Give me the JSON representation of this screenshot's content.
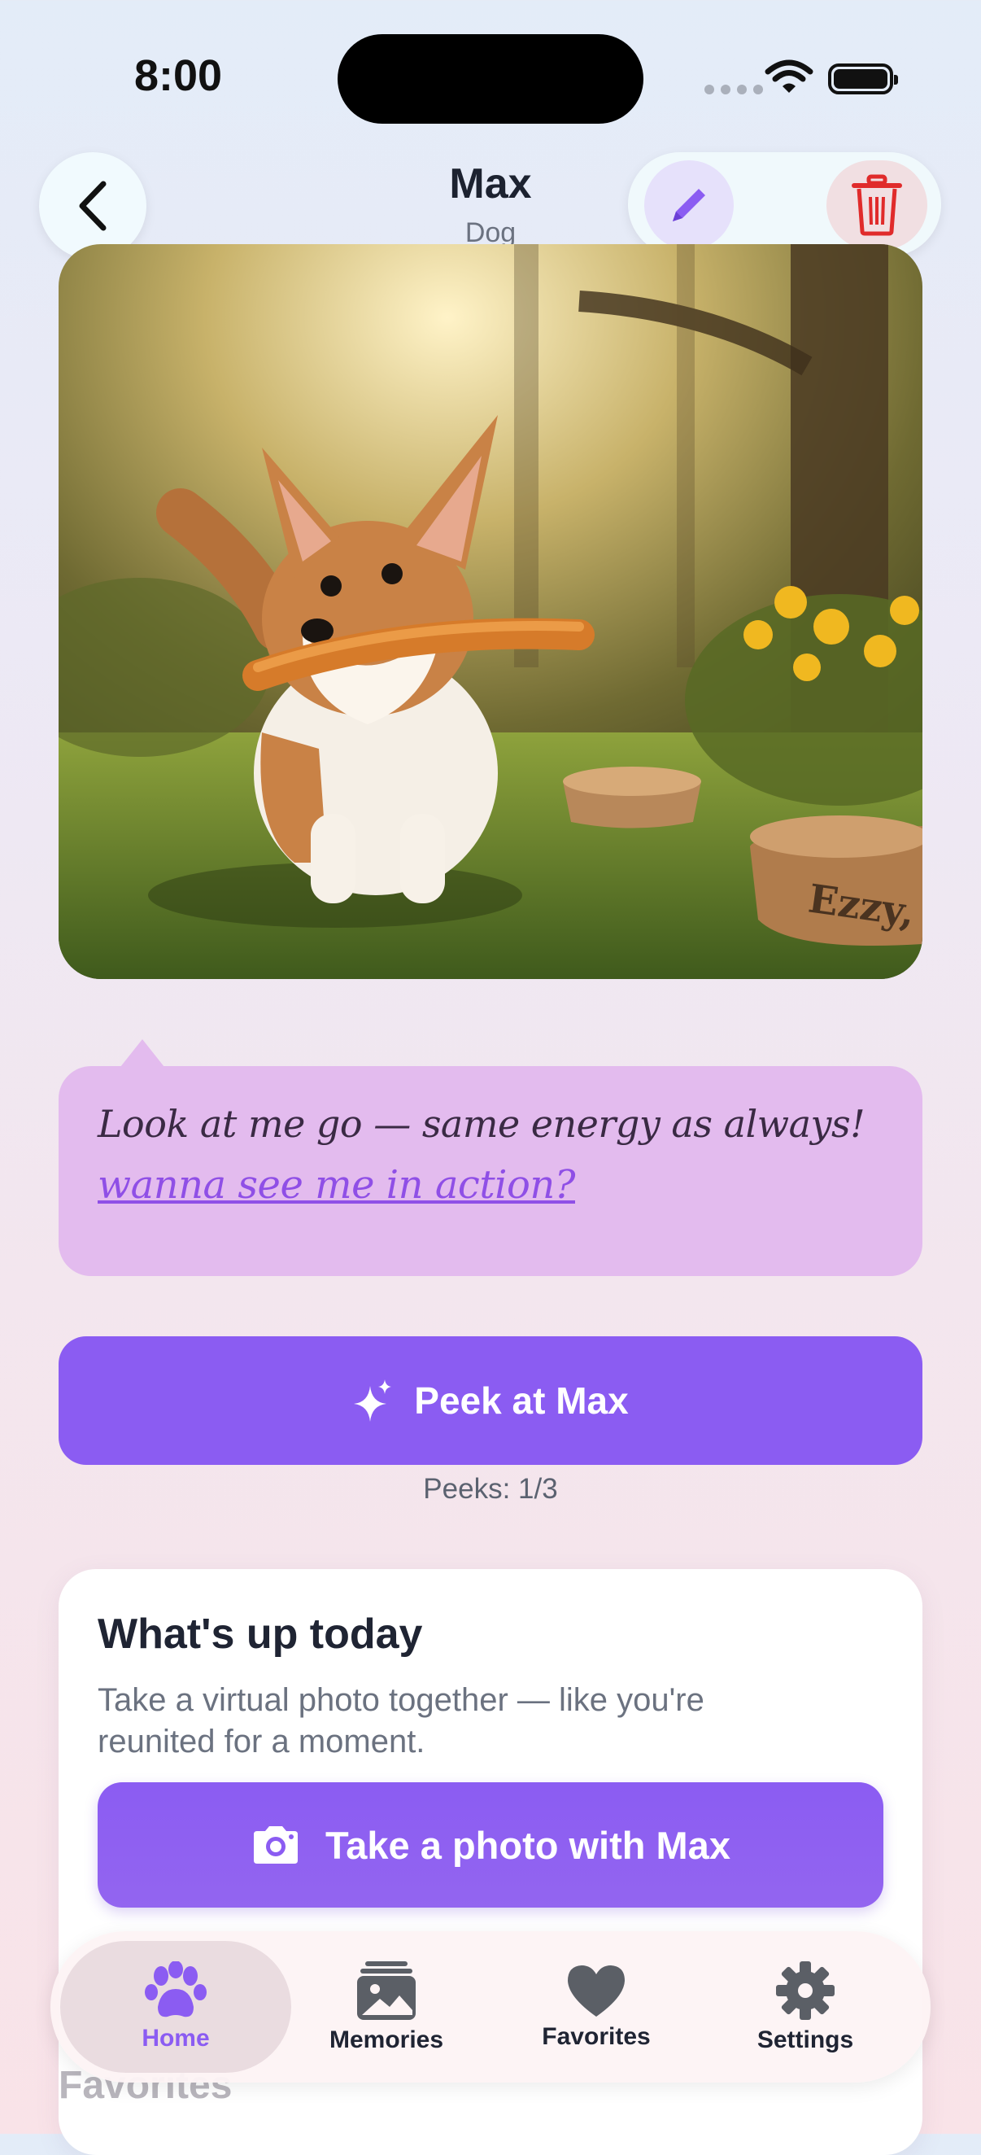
{
  "status_bar": {
    "time": "8:00"
  },
  "header": {
    "title": "Max",
    "subtitle": "Dog"
  },
  "photo": {
    "alt": "corgi puppy carrying a stick in a sunlit garden",
    "bowl_text": "Ezzy, l"
  },
  "bubble": {
    "message": "Look at me go — same energy as always!",
    "link": "wanna see me in action?"
  },
  "peek": {
    "button_label": "Peek at Max",
    "count_text": "Peeks: 1/3"
  },
  "card": {
    "title": "What's up today",
    "description": "Take a virtual photo together — like you're reunited for a moment.",
    "photo_button_label": "Take a photo with Max"
  },
  "favorites_heading": "Favorites",
  "tabs": [
    {
      "label": "Home",
      "icon": "paw-icon",
      "active": true
    },
    {
      "label": "Memories",
      "icon": "photo-stack-icon",
      "active": false
    },
    {
      "label": "Favorites",
      "icon": "heart-icon",
      "active": false
    },
    {
      "label": "Settings",
      "icon": "gear-icon",
      "active": false
    }
  ],
  "colors": {
    "accent": "#8b5cf2",
    "bubble": "#e3bbee",
    "danger": "#e02b2b"
  }
}
